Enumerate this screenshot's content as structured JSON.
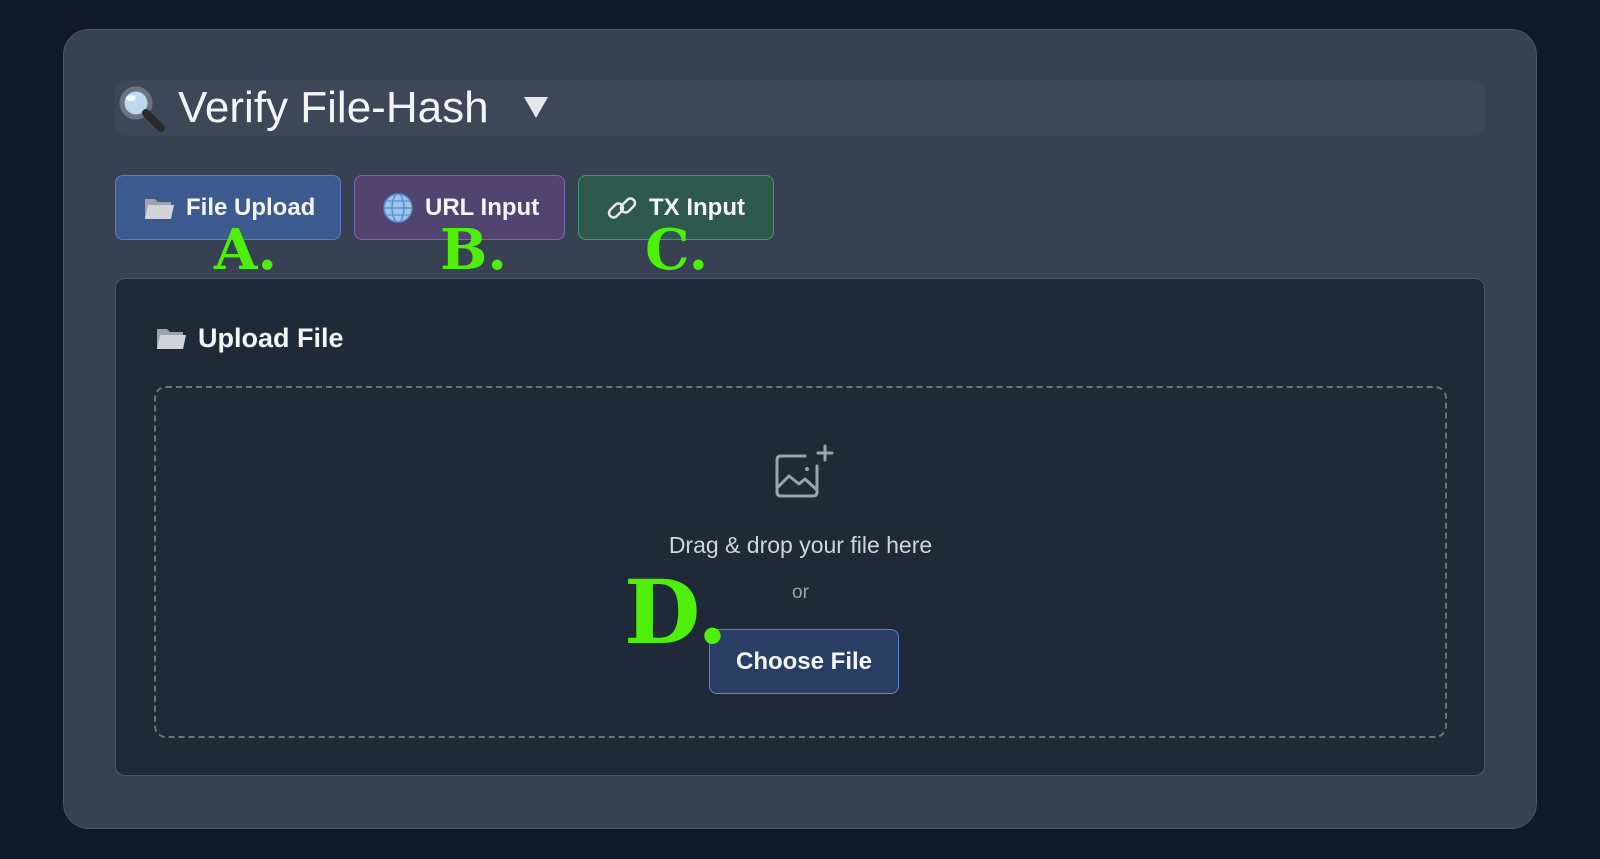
{
  "header": {
    "title": "Verify File-Hash",
    "icons": {
      "leading": "magnifier-icon",
      "trailing": "triangle-down-icon"
    }
  },
  "tabs": [
    {
      "label": "File Upload",
      "icon": "folder-icon",
      "color": "#3c5a8d"
    },
    {
      "label": "URL Input",
      "icon": "globe-icon",
      "color": "#51456f"
    },
    {
      "label": "TX Input",
      "icon": "link-icon",
      "color": "#2e5a4e"
    }
  ],
  "markers": {
    "a": "A.",
    "b": "B.",
    "c": "C.",
    "d": "D."
  },
  "panel": {
    "title": "Upload File",
    "title_icon": "folder-icon",
    "dropzone": {
      "icon": "image-add-icon",
      "drag_text": "Drag & drop your file here",
      "or_text": "or",
      "choose_button": "Choose File"
    }
  },
  "colors": {
    "background": "#111827",
    "card": "#374151",
    "panel": "#1f2937",
    "marker": "#4ef00a"
  }
}
